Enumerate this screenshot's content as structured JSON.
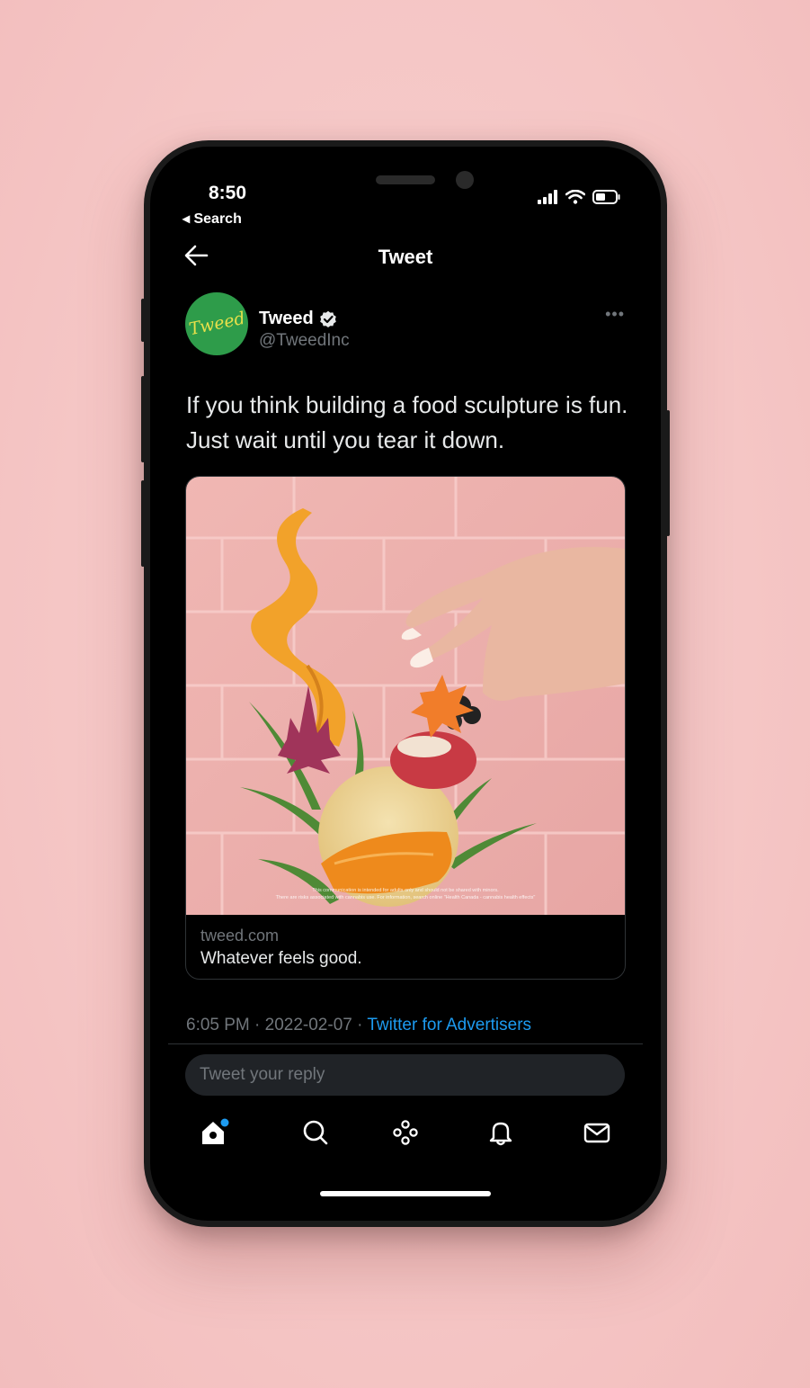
{
  "status_bar": {
    "time": "8:50",
    "back_app": "◂ Search"
  },
  "header": {
    "title": "Tweet"
  },
  "tweet": {
    "author_name": "Tweed",
    "author_handle": "@TweedInc",
    "avatar_text": "Tweed",
    "text": "If you think building a food sculpture is fun. Just wait until you tear it down.",
    "card": {
      "domain": "tweed.com",
      "title": "Whatever feels good.",
      "disclaimer_line1": "This communication is intended for adults only and should not be shared with minors.",
      "disclaimer_line2": "There are risks associated with cannabis use. For information, search online \"Health Canada - cannabis health effects\""
    },
    "time": "6:05 PM · 2022-02-07 · ",
    "source": "Twitter for Advertisers"
  },
  "reply": {
    "placeholder": "Tweet your reply"
  },
  "tabs": [
    "home-icon",
    "search-icon",
    "spaces-icon",
    "notifications-icon",
    "messages-icon"
  ],
  "colors": {
    "accent": "#1d9bf0",
    "background": "#000000",
    "page": "#f5c6c5"
  }
}
